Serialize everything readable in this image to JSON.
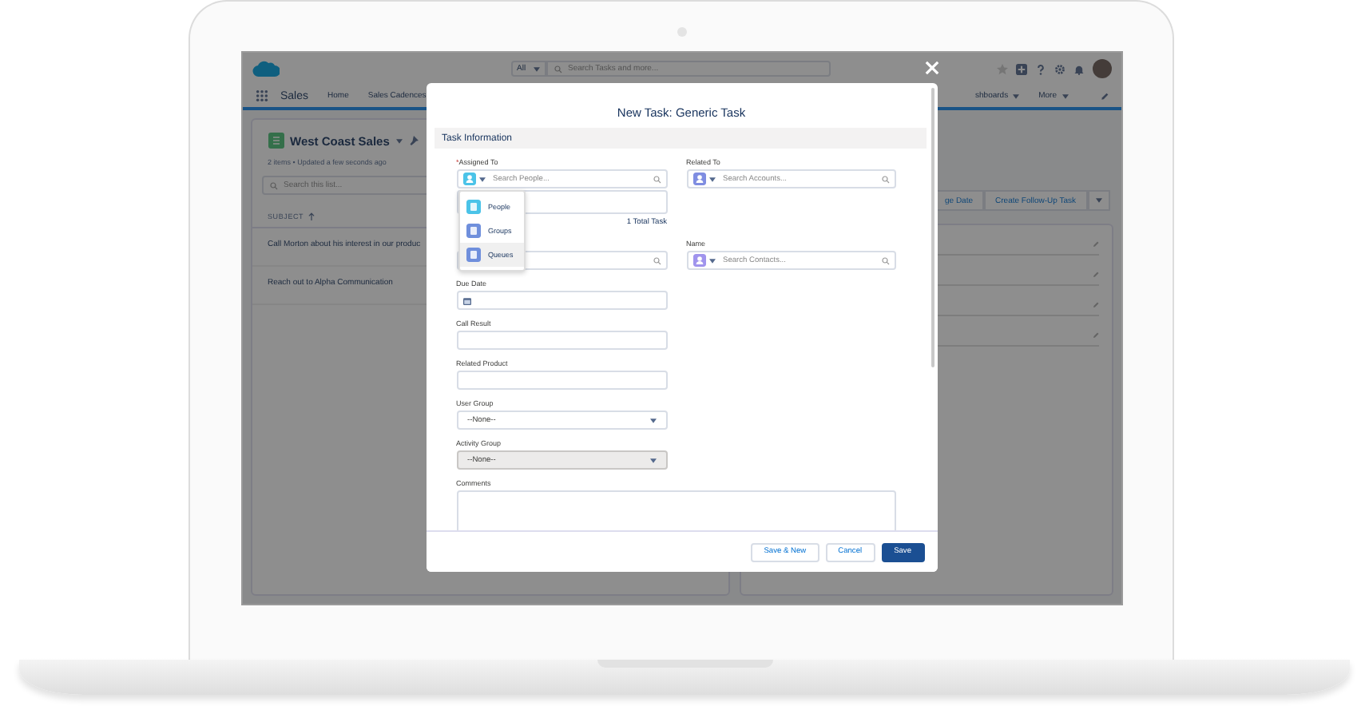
{
  "header": {
    "search_scope": "All",
    "search_placeholder": "Search Tasks and more..."
  },
  "nav": {
    "app_name": "Sales",
    "items": [
      {
        "label": "Home",
        "caret": false
      },
      {
        "label": "Sales Cadences",
        "caret": false
      },
      {
        "label": "shboards",
        "caret": true
      },
      {
        "label": "More",
        "caret": true
      }
    ]
  },
  "list_view": {
    "title": "West Coast Sales",
    "meta": "2 items • Updated a few seconds ago",
    "search_placeholder": "Search this list...",
    "column": "SUBJECT",
    "rows": [
      "Call Morton about his interest in our produc",
      "Reach out to Alpha Communication"
    ]
  },
  "actions": [
    "ge Date",
    "Create Follow-Up Task"
  ],
  "modal": {
    "title": "New Task: Generic Task",
    "section": "Task Information",
    "rows": [
      {
        "left": {
          "kind": "lookup",
          "label": "Assigned To",
          "required_mark": "*",
          "color": "#4bc3e8",
          "placeholder": "Search People...",
          "results_count": "1 Total Task"
        },
        "right": {
          "kind": "lookup",
          "label": "Related To",
          "color": "#7f8de1",
          "placeholder": "Search Accounts..."
        }
      },
      {
        "left": {
          "kind": "search"
        },
        "right": {
          "kind": "lookup",
          "label": "Name",
          "color": "#a094ed",
          "placeholder": "Search Contacts..."
        }
      },
      {
        "left": {
          "kind": "date",
          "label": "Due Date"
        }
      },
      {
        "left": {
          "kind": "text",
          "label": "Call Result"
        }
      },
      {
        "left": {
          "kind": "text",
          "label": "Related Product"
        }
      },
      {
        "left": {
          "kind": "select",
          "label": "User Group",
          "value": "--None--",
          "disabled": false
        }
      },
      {
        "left": {
          "kind": "select",
          "label": "Activity Group",
          "value": "--None--",
          "disabled": true
        }
      },
      {
        "wide": {
          "kind": "textarea",
          "label": "Comments"
        }
      }
    ],
    "menu": [
      {
        "label": "People",
        "color": "#4bc3e8",
        "selected": false
      },
      {
        "label": "Groups",
        "color": "#6f8fdc",
        "selected": false
      },
      {
        "label": "Queues",
        "color": "#6f8fdc",
        "selected": true
      }
    ],
    "buttons": [
      {
        "label": "Save & New",
        "kind": "neutral"
      },
      {
        "label": "Cancel",
        "kind": "neutral"
      },
      {
        "label": "Save",
        "kind": "brand"
      }
    ]
  }
}
